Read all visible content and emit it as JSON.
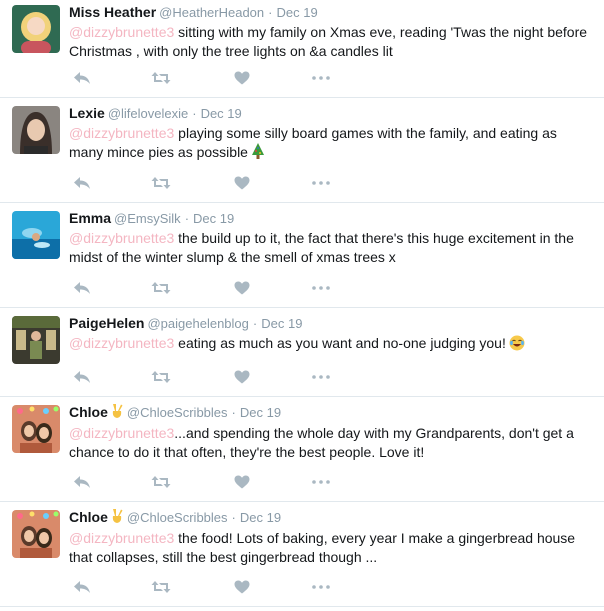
{
  "tweets": [
    {
      "name": "Miss Heather",
      "handle": "@HeatherHeadon",
      "date": "Dec 19",
      "mention": "@dizzybrunette3",
      "text": " sitting with my family on Xmas eve, reading 'Twas the night before Christmas , with only the tree lights on &a candles lit",
      "avatar_colors": [
        "#c8555e",
        "#f1d27a",
        "#7a2a3a"
      ],
      "emoji": ""
    },
    {
      "name": "Lexie",
      "handle": "@lifelovelexie",
      "date": "Dec 19",
      "mention": "@dizzybrunette3",
      "text": " playing some silly board games with the family, and eating as many mince pies as possible",
      "avatar_colors": [
        "#3a2f2a",
        "#e8c9b0",
        "#6b4b3a"
      ],
      "emoji": "christmas-tree-icon"
    },
    {
      "name": "Emma",
      "handle": "@EmsySilk",
      "date": "Dec 19",
      "mention": "@dizzybrunette3",
      "text": " the build up to it, the fact that there's this huge excitement in the midst of the winter slump & the smell of xmas trees x",
      "avatar_colors": [
        "#2aa7d8",
        "#0d6fa8",
        "#8fd6f0"
      ],
      "emoji": ""
    },
    {
      "name": "PaigeHelen",
      "handle": "@paigehelenblog",
      "date": "Dec 19",
      "mention": "@dizzybrunette3",
      "text": " eating as much as you want and no-one judging you!",
      "avatar_colors": [
        "#3b3a2f",
        "#7a8a52",
        "#c9b98a"
      ],
      "emoji": "face-with-tears-of-joy-icon"
    },
    {
      "name": "Chloe",
      "handle": "@ChloeScribbles",
      "date": "Dec 19",
      "mention": "@dizzybrunette3",
      "text": "...and spending the whole day with my Grandparents, don't get a chance to do it that often, they're the best people. Love it!",
      "avatar_colors": [
        "#b05a3c",
        "#f0c8a8",
        "#5a3a2a"
      ],
      "emoji": "victory-hand-icon"
    },
    {
      "name": "Chloe",
      "handle": "@ChloeScribbles",
      "date": "Dec 19",
      "mention": "@dizzybrunette3",
      "text": " the food! Lots of baking, every year I make a gingerbread house that collapses, still the best gingerbread though ...",
      "avatar_colors": [
        "#b05a3c",
        "#f0c8a8",
        "#5a3a2a"
      ],
      "emoji": "victory-hand-icon"
    }
  ],
  "action_icons": [
    "reply-icon",
    "retweet-icon",
    "like-icon",
    "more-icon"
  ],
  "colors": {
    "mention": "#f4b6c2",
    "meta": "#8899a6",
    "icon": "#aab8c2",
    "divider": "#e1e8ed"
  }
}
